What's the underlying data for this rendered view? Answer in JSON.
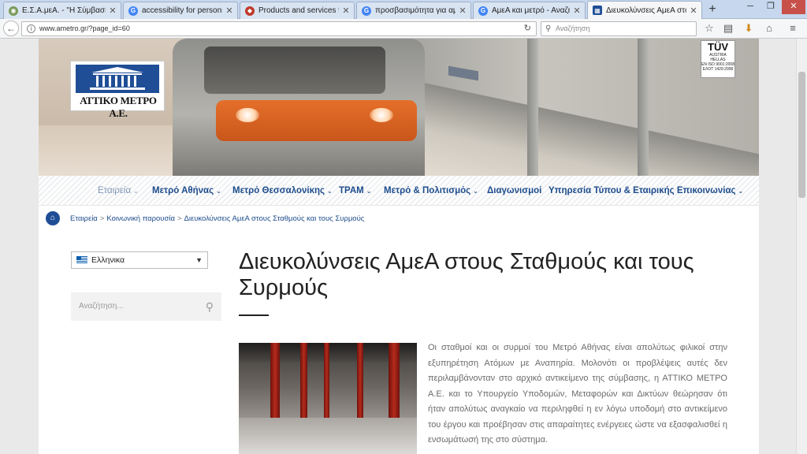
{
  "browser": {
    "tabs": [
      {
        "label": "Ε.Σ.Α.μεΑ. - \"Η Σύμβαση",
        "icon": "globe-icon",
        "active": false
      },
      {
        "label": "accessibility for persons w",
        "icon": "google-icon",
        "active": false
      },
      {
        "label": "Products and services to i",
        "icon": "page-icon",
        "active": false
      },
      {
        "label": "προσβασιμότητα για αμε",
        "icon": "google-icon",
        "active": false
      },
      {
        "label": "ΑμεΑ και μετρό - Αναζήτη",
        "icon": "google-icon",
        "active": false
      },
      {
        "label": "Διευκολύνσεις ΑμεΑ στους",
        "icon": "ametro-icon",
        "active": true
      }
    ],
    "new_tab": "+",
    "url": "www.ametro.gr/?page_id=60",
    "search_placeholder": "Αναζήτηση",
    "colors": {
      "accent": "#1d4c8c",
      "tab_strip": "#c6d7ee"
    }
  },
  "site": {
    "logo_text": "ΑΤΤΙΚΟ ΜΕΤΡΟ Α.Ε.",
    "tuv": {
      "brand": "TÜV",
      "line1": "AUSTRIA",
      "line2": "HELLAS",
      "line3": "EN ISO 9001:2008",
      "line4": "ΕΛΟΤ 1429:2008"
    },
    "menu": [
      {
        "label": "Εταιρεία",
        "dropdown": true,
        "muted": true
      },
      {
        "label": "Μετρό Αθήνας",
        "dropdown": true
      },
      {
        "label": "Μετρό Θεσσαλονίκης",
        "dropdown": true
      },
      {
        "label": "ΤΡΑΜ",
        "dropdown": true
      },
      {
        "label": "Μετρό & Πολιτισμός",
        "dropdown": true
      },
      {
        "label": "Διαγωνισμοί",
        "dropdown": false
      },
      {
        "label": "Υπηρεσία Τύπου & Εταιρικής Επικοινωνίας",
        "dropdown": true
      }
    ],
    "breadcrumb": [
      {
        "label": "Εταιρεία",
        "link": true
      },
      {
        "label": "Κοινωνική παρουσία",
        "link": true
      },
      {
        "label": "Διευκολύνσεις ΑμεΑ στους Σταθμούς και τους Συρμούς",
        "link": true
      }
    ],
    "breadcrumb_sep": ">",
    "sidebar": {
      "language": "Ελληνικα",
      "search_placeholder": "Αναζήτηση..."
    },
    "article": {
      "title": "Διευκολύνσεις ΑμεΑ στους Σταθμούς και τους Συρμούς",
      "body": "Οι σταθμοί και οι συρμοί του Μετρό Αθήνας είναι απολύτως φιλικοί στην εξυπηρέτηση Ατόμων με Αναπηρία. Μολονότι οι προβλέψεις αυτές δεν περιλαμβάνονταν στο αρχικό αντικείμενο της σύμβασης, η ΑΤΤΙΚΟ ΜΕΤΡΟ Α.Ε. και το Υπουργείο Υποδομών, Μεταφορών και Δικτύων θεώρησαν ότι ήταν απολύτως αναγκαίο να περιληφθεί η εν λόγω υποδομή στο αντικείμενο του έργου και προέβησαν στις απαραίτητες ενέργειες ώστε να εξασφαλισθεί η ενσωμάτωσή της στο σύστημα."
    }
  }
}
